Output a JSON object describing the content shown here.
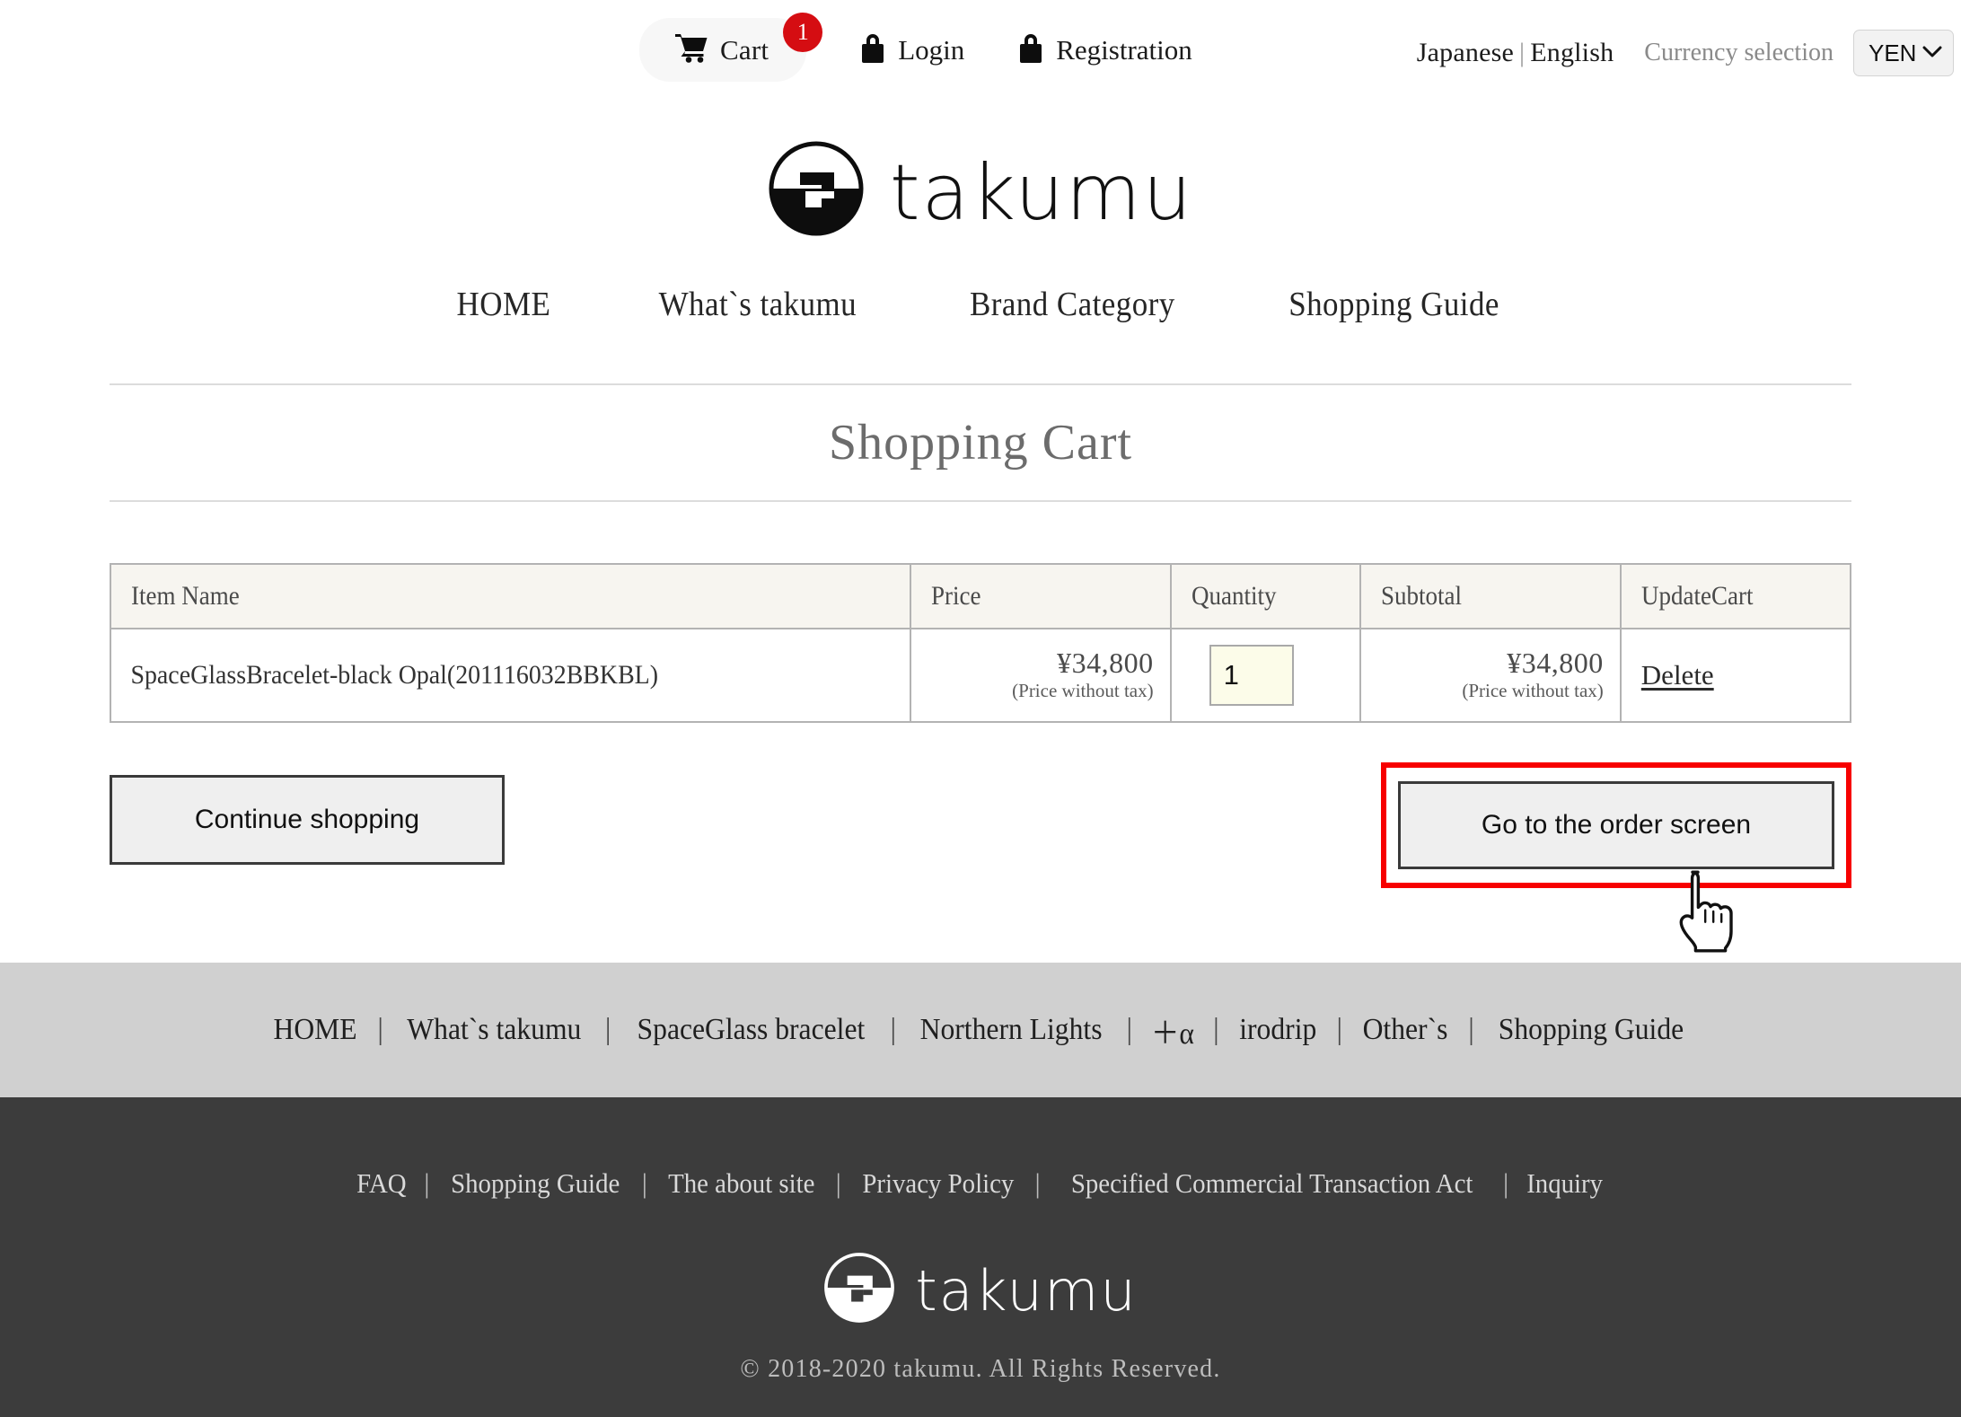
{
  "utility": {
    "cart": {
      "label": "Cart",
      "badge": "1",
      "icon": "shopping-cart-icon"
    },
    "login": {
      "label": "Login",
      "icon": "lock-icon"
    },
    "registration": {
      "label": "Registration",
      "icon": "lock-icon"
    },
    "lang_japanese": "Japanese",
    "lang_separator": "|",
    "lang_english": "English",
    "currency_label": "Currency selection",
    "currency_value": "YEN",
    "currency_caret": "∨"
  },
  "brand": {
    "wordmark": "takumu",
    "logo_icon": "takumu-circle-logo"
  },
  "nav": {
    "items": [
      {
        "label": "HOME"
      },
      {
        "label": "What`s takumu"
      },
      {
        "label": "Brand Category"
      },
      {
        "label": "Shopping Guide"
      }
    ]
  },
  "page": {
    "title": "Shopping Cart"
  },
  "cart_table": {
    "headers": [
      "Item Name",
      "Price",
      "Quantity",
      "Subtotal",
      "UpdateCart"
    ],
    "rows": [
      {
        "item_name": "SpaceGlassBracelet-black Opal(201116032BBKBL)",
        "price": "¥34,800",
        "price_note": "(Price without tax)",
        "quantity": "1",
        "subtotal": "¥34,800",
        "subtotal_note": "(Price without tax)",
        "update_action": "Delete"
      }
    ]
  },
  "actions": {
    "continue_label": "Continue shopping",
    "order_label": "Go to the order screen",
    "highlight_color": "#f70000",
    "cursor": "pointing-hand-cursor"
  },
  "gray_nav": {
    "separator": "|",
    "items": [
      {
        "label": "HOME"
      },
      {
        "label": "What`s takumu"
      },
      {
        "label": "SpaceGlass bracelet"
      },
      {
        "label": "Northern Lights"
      },
      {
        "label": "＋α"
      },
      {
        "label": "irodrip"
      },
      {
        "label": "Other`s"
      },
      {
        "label": "Shopping Guide"
      }
    ]
  },
  "footer": {
    "separator": "|",
    "links": [
      {
        "label": "FAQ"
      },
      {
        "label": "Shopping Guide"
      },
      {
        "label": "The about site"
      },
      {
        "label": "Privacy Policy"
      },
      {
        "label": "Specified Commercial Transaction Act"
      },
      {
        "label": "Inquiry"
      }
    ],
    "wordmark": "takumu",
    "copyright": "© 2018-2020 takumu. All Rights Reserved."
  },
  "colors": {
    "badge_red": "#d50d12",
    "highlight_red": "#f70000",
    "gray_band": "#d0d0d0",
    "dark_footer": "#3c3c3c",
    "table_header": "#f7f5f0",
    "qty_field": "#fcfce9"
  }
}
